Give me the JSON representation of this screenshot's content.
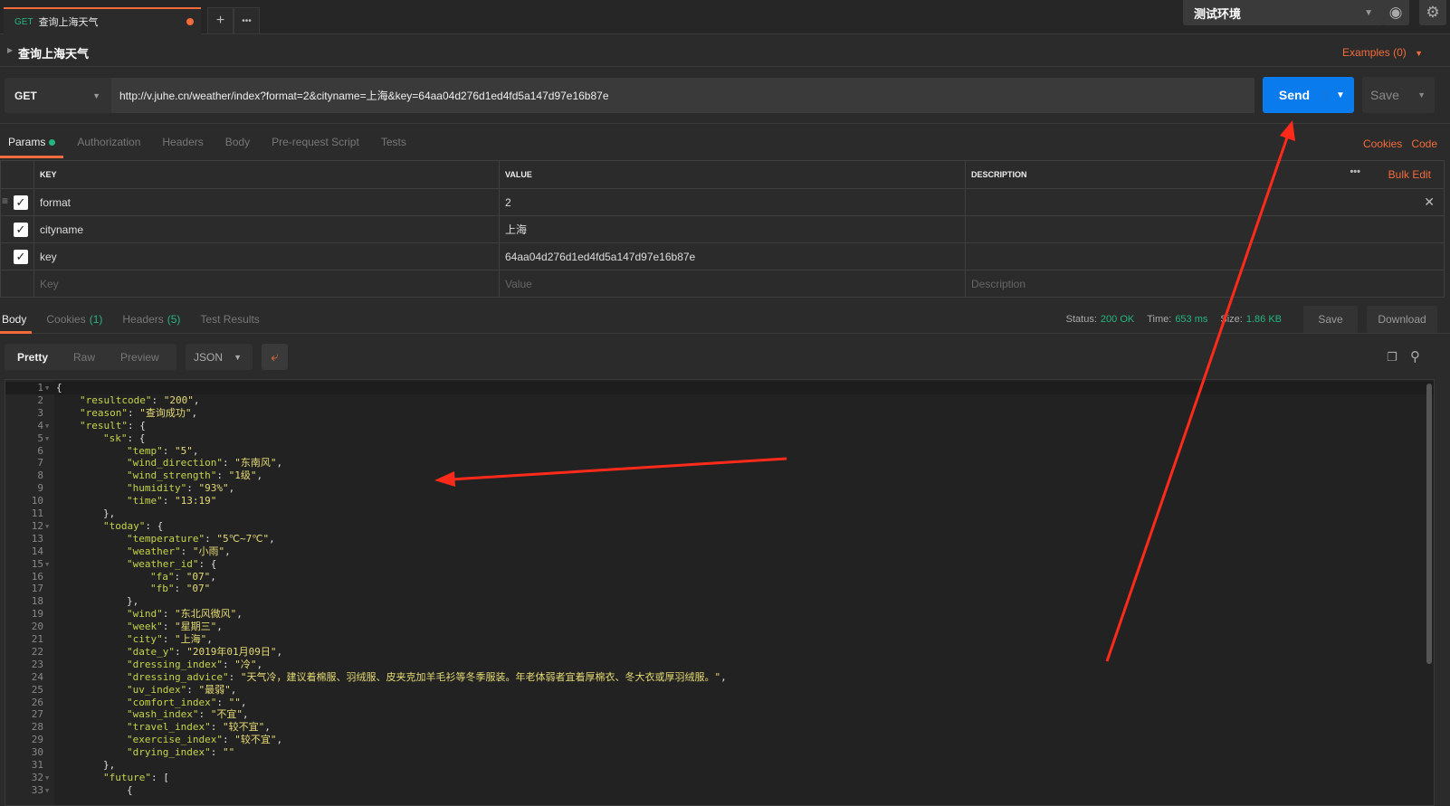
{
  "tabs": {
    "method": "GET",
    "title": "查询上海天气",
    "new_tab": "+",
    "more": "•••"
  },
  "environment": {
    "selected": "测试环境"
  },
  "request": {
    "name": "查询上海天气",
    "examples": "Examples (0)",
    "method": "GET",
    "url": "http://v.juhe.cn/weather/index?format=2&cityname=上海&key=64aa04d276d1ed4fd5a147d97e16b87e",
    "send": "Send",
    "save": "Save"
  },
  "req_tabs": [
    "Params",
    "Authorization",
    "Headers",
    "Body",
    "Pre-request Script",
    "Tests"
  ],
  "req_links": {
    "cookies": "Cookies",
    "code": "Code"
  },
  "params": {
    "headers": [
      "KEY",
      "VALUE",
      "DESCRIPTION"
    ],
    "bulk_edit": "Bulk Edit",
    "rows": [
      {
        "key": "format",
        "value": "2",
        "description": "",
        "checked": true
      },
      {
        "key": "cityname",
        "value": "上海",
        "description": "",
        "checked": true
      },
      {
        "key": "key",
        "value": "64aa04d276d1ed4fd5a147d97e16b87e",
        "description": "",
        "checked": true
      }
    ],
    "placeholders": {
      "key": "Key",
      "value": "Value",
      "description": "Description"
    }
  },
  "response": {
    "tabs": [
      {
        "label": "Body",
        "count": ""
      },
      {
        "label": "Cookies",
        "count": "(1)"
      },
      {
        "label": "Headers",
        "count": "(5)"
      },
      {
        "label": "Test Results",
        "count": ""
      }
    ],
    "status_label": "Status:",
    "status": "200 OK",
    "time_label": "Time:",
    "time": "653 ms",
    "size_label": "Size:",
    "size": "1.86 KB",
    "save": "Save",
    "download": "Download",
    "views": [
      "Pretty",
      "Raw",
      "Preview"
    ],
    "format": "JSON"
  },
  "colors": {
    "accent": "#f26b3a",
    "send": "#097bed",
    "success": "#26b47f",
    "annotation_arrow": "#ff2a1a"
  },
  "code_lines": [
    {
      "i": 0,
      "p": "{",
      "f": true
    },
    {
      "i": 1,
      "k": "\"resultcode\"",
      "v": "\"200\"",
      "t": ","
    },
    {
      "i": 1,
      "k": "\"reason\"",
      "v": "\"查询成功\"",
      "t": ","
    },
    {
      "i": 1,
      "k": "\"result\"",
      "t": ": {",
      "f": true
    },
    {
      "i": 2,
      "k": "\"sk\"",
      "t": ": {",
      "f": true
    },
    {
      "i": 3,
      "k": "\"temp\"",
      "v": "\"5\"",
      "t": ","
    },
    {
      "i": 3,
      "k": "\"wind_direction\"",
      "v": "\"东南风\"",
      "t": ","
    },
    {
      "i": 3,
      "k": "\"wind_strength\"",
      "v": "\"1级\"",
      "t": ","
    },
    {
      "i": 3,
      "k": "\"humidity\"",
      "v": "\"93%\"",
      "t": ","
    },
    {
      "i": 3,
      "k": "\"time\"",
      "v": "\"13:19\""
    },
    {
      "i": 2,
      "p": "},"
    },
    {
      "i": 2,
      "k": "\"today\"",
      "t": ": {",
      "f": true
    },
    {
      "i": 3,
      "k": "\"temperature\"",
      "v": "\"5℃~7℃\"",
      "t": ","
    },
    {
      "i": 3,
      "k": "\"weather\"",
      "v": "\"小雨\"",
      "t": ","
    },
    {
      "i": 3,
      "k": "\"weather_id\"",
      "t": ": {",
      "f": true
    },
    {
      "i": 4,
      "k": "\"fa\"",
      "v": "\"07\"",
      "t": ","
    },
    {
      "i": 4,
      "k": "\"fb\"",
      "v": "\"07\""
    },
    {
      "i": 3,
      "p": "},"
    },
    {
      "i": 3,
      "k": "\"wind\"",
      "v": "\"东北风微风\"",
      "t": ","
    },
    {
      "i": 3,
      "k": "\"week\"",
      "v": "\"星期三\"",
      "t": ","
    },
    {
      "i": 3,
      "k": "\"city\"",
      "v": "\"上海\"",
      "t": ","
    },
    {
      "i": 3,
      "k": "\"date_y\"",
      "v": "\"2019年01月09日\"",
      "t": ","
    },
    {
      "i": 3,
      "k": "\"dressing_index\"",
      "v": "\"冷\"",
      "t": ","
    },
    {
      "i": 3,
      "k": "\"dressing_advice\"",
      "v": "\"天气冷，建议着棉服、羽绒服、皮夹克加羊毛衫等冬季服装。年老体弱者宜着厚棉衣、冬大衣或厚羽绒服。\"",
      "t": ","
    },
    {
      "i": 3,
      "k": "\"uv_index\"",
      "v": "\"最弱\"",
      "t": ","
    },
    {
      "i": 3,
      "k": "\"comfort_index\"",
      "v": "\"\"",
      "t": ","
    },
    {
      "i": 3,
      "k": "\"wash_index\"",
      "v": "\"不宜\"",
      "t": ","
    },
    {
      "i": 3,
      "k": "\"travel_index\"",
      "v": "\"较不宜\"",
      "t": ","
    },
    {
      "i": 3,
      "k": "\"exercise_index\"",
      "v": "\"较不宜\"",
      "t": ","
    },
    {
      "i": 3,
      "k": "\"drying_index\"",
      "v": "\"\""
    },
    {
      "i": 2,
      "p": "},"
    },
    {
      "i": 2,
      "k": "\"future\"",
      "t": ": [",
      "f": true
    },
    {
      "i": 3,
      "p": "{",
      "f": true
    }
  ]
}
